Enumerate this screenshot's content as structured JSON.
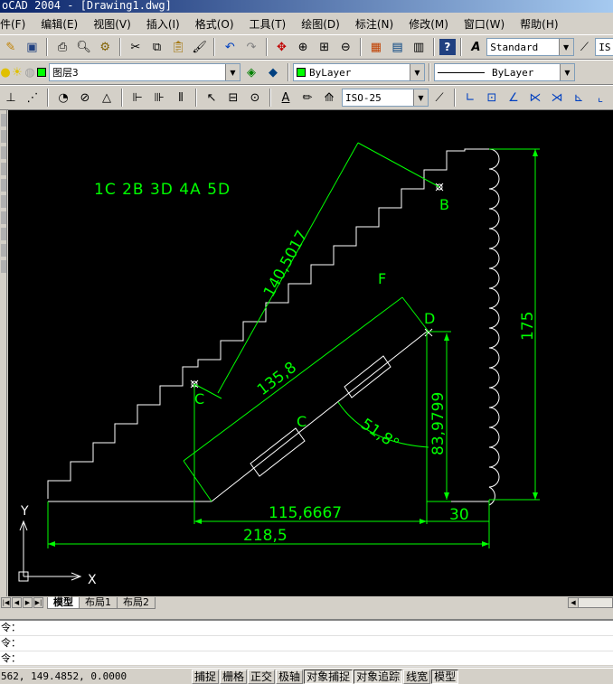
{
  "window": {
    "title": "oCAD 2004 - [Drawing1.dwg]"
  },
  "menu": [
    "件(F)",
    "编辑(E)",
    "视图(V)",
    "插入(I)",
    "格式(O)",
    "工具(T)",
    "绘图(D)",
    "标注(N)",
    "修改(M)",
    "窗口(W)",
    "帮助(H)"
  ],
  "toolbar1": {
    "text_style": "Standard",
    "dim_style_partial": "IS"
  },
  "toolbar2": {
    "layer": "图层3",
    "color": "ByLayer",
    "linetype": "ByLayer"
  },
  "toolbar3": {
    "dim_style": "ISO-25"
  },
  "drawing": {
    "legend": "1C 2B 3D 4A 5D",
    "points": {
      "b": "B",
      "c": "C",
      "d": "D",
      "f": "F",
      "c2": "C"
    },
    "dims": {
      "d1": "140,5017",
      "d2": "135,8",
      "d3": "51,8°",
      "d4": "83,9799",
      "d5": "175",
      "d6": "115,6667",
      "d7": "30",
      "d8": "218,5"
    },
    "ucs": {
      "x": "X",
      "y": "Y"
    }
  },
  "tabs": [
    "模型",
    "布局1",
    "布局2"
  ],
  "command_lines": [
    "令：",
    "令：",
    "令："
  ],
  "status": {
    "coords": "562,  149.4852,  0.0000",
    "buttons": [
      "捕捉",
      "栅格",
      "正交",
      "极轴",
      "对象捕捉",
      "对象追踪",
      "线宽",
      "模型"
    ]
  },
  "colors": {
    "drawing_line": "#00ff00",
    "canvas": "#000000",
    "crosshair": "#ffffff"
  }
}
